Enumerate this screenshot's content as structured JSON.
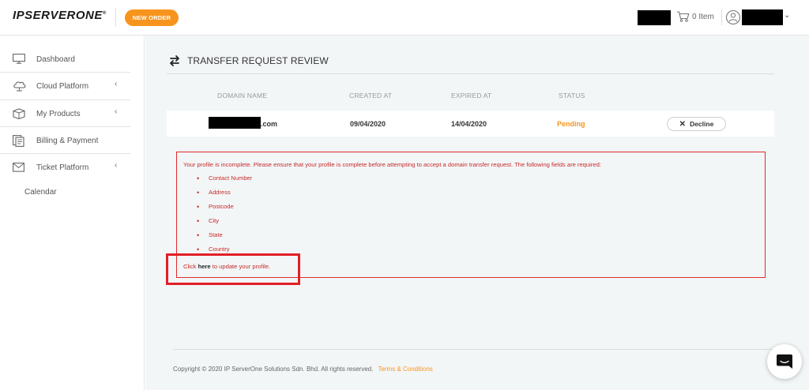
{
  "header": {
    "logo_text": "IPSERVERONE",
    "logo_mark": "®",
    "new_order_label": "NEW ORDER",
    "cart_text": "0 Item"
  },
  "sidebar": {
    "items": [
      {
        "label": "Dashboard",
        "icon": "monitor-icon",
        "has_caret": false
      },
      {
        "label": "Cloud Platform",
        "icon": "cloud-icon",
        "has_caret": true
      },
      {
        "label": "My Products",
        "icon": "box-icon",
        "has_caret": true
      },
      {
        "label": "Billing & Payment",
        "icon": "invoice-icon",
        "has_caret": false
      },
      {
        "label": "Ticket Platform",
        "icon": "envelope-icon",
        "has_caret": true
      }
    ],
    "caret": "‹",
    "calendar_label": "Calendar"
  },
  "main": {
    "title": "TRANSFER REQUEST REVIEW",
    "table": {
      "headers": [
        "DOMAIN NAME",
        "CREATED AT",
        "EXPIRED AT",
        "STATUS"
      ],
      "rows": [
        {
          "domain_suffix": ".com",
          "created": "09/04/2020",
          "expired": "14/04/2020",
          "status": "Pending",
          "action_label": "Decline"
        }
      ]
    },
    "alert": {
      "message": "Your profile is incomplete. Please ensure that your profile is complete before attempting to accept a domain transfer request. The following fields are required:",
      "fields": [
        "Contact Number",
        "Address",
        "Postcode",
        "City",
        "State",
        "Country"
      ],
      "link_prefix": "Click ",
      "link_text": "here",
      "link_suffix": " to update your profile."
    },
    "footer": {
      "copyright": "Copyright © 2020 IP ServerOne Solutions Sdn. Bhd. All rights reserved.",
      "terms_label": "Terms & Conditions"
    }
  },
  "colors": {
    "accent": "#f7941d",
    "alert": "#c52b2b",
    "highlight": "#e21f26",
    "main_bg": "#f3f6f7"
  }
}
